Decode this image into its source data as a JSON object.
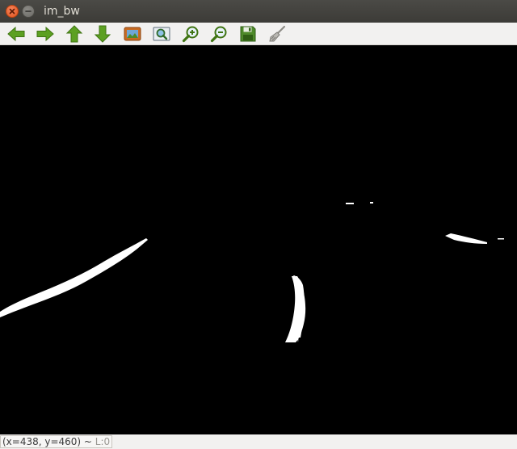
{
  "window": {
    "title": "im_bw"
  },
  "toolbar": {
    "buttons": [
      {
        "name": "pan-left",
        "icon": "arrow-left-icon"
      },
      {
        "name": "pan-right",
        "icon": "arrow-right-icon"
      },
      {
        "name": "pan-up",
        "icon": "arrow-up-icon"
      },
      {
        "name": "pan-down",
        "icon": "arrow-down-icon"
      },
      {
        "name": "zoom-original",
        "icon": "image-icon"
      },
      {
        "name": "zoom-fit",
        "icon": "zoom-fit-icon"
      },
      {
        "name": "zoom-in",
        "icon": "zoom-in-icon"
      },
      {
        "name": "zoom-out",
        "icon": "zoom-out-icon"
      },
      {
        "name": "save",
        "icon": "floppy-icon"
      },
      {
        "name": "properties",
        "icon": "brush-icon"
      }
    ]
  },
  "status": {
    "coords": "(x=438, y=460) ~ ",
    "level": "L:0"
  },
  "colors": {
    "titlebar": "#3c3b37",
    "close": "#e0531c",
    "toolbar_icon": "#4e9a06",
    "canvas_bg": "#000000",
    "foreground": "#ffffff"
  }
}
